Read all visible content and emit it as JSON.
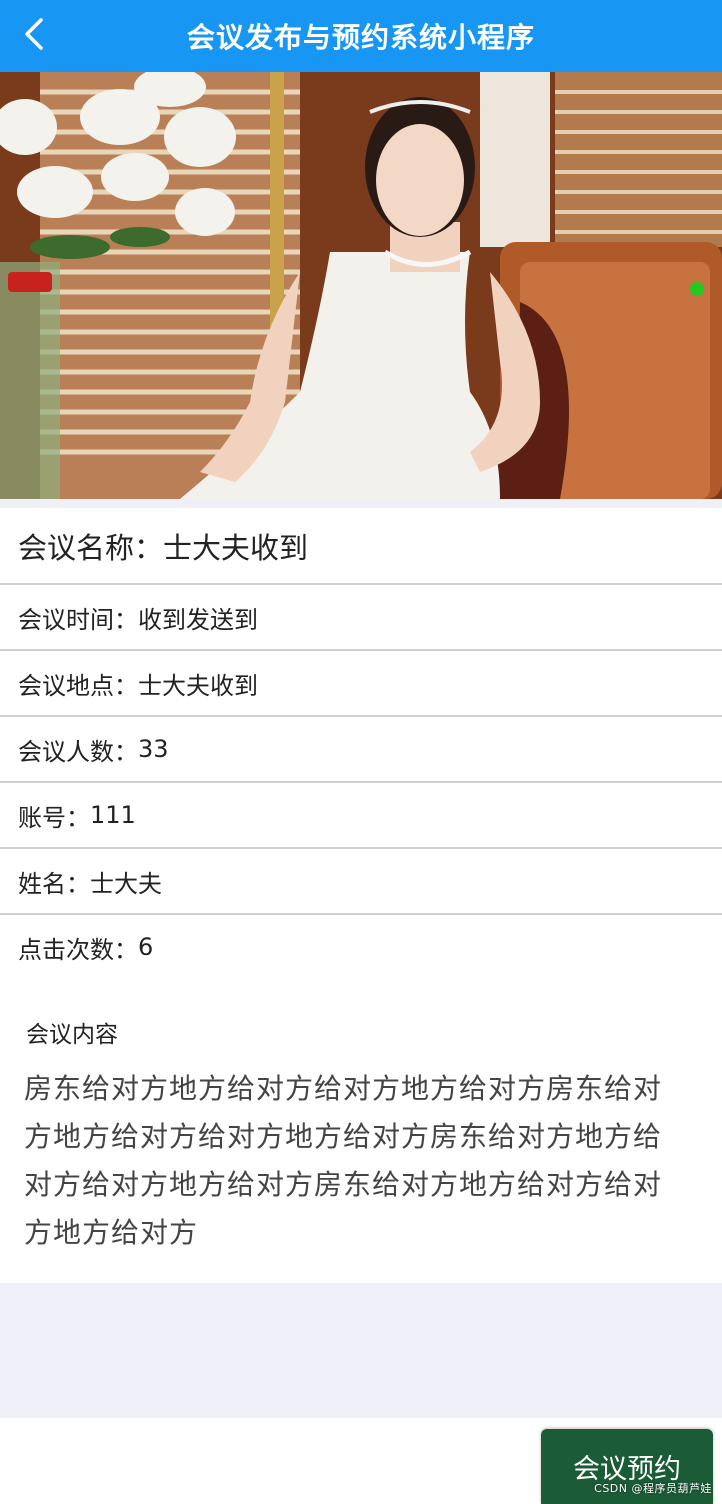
{
  "app": {
    "title": "会议发布与预约系统小程序"
  },
  "nav": {
    "back_icon": "chevron-left-icon"
  },
  "hero": {
    "alt": "会议图片"
  },
  "meeting": {
    "name_label": "会议名称：",
    "name_value": "士大夫收到",
    "time_label": "会议时间：",
    "time_value": "收到发送到",
    "location_label": "会议地点：",
    "location_value": "士大夫收到",
    "people_label": "会议人数：",
    "people_value": "33",
    "account_label": "账号：",
    "account_value": "111",
    "username_label": "姓名：",
    "username_value": "士大夫",
    "clicks_label": "点击次数：",
    "clicks_value": "6"
  },
  "content": {
    "title": "会议内容",
    "body": "房东给对方地方给对方给对方地方给对方房东给对方地方给对方给对方地方给对方房东给对方地方给对方给对方地方给对方房东给对方地方给对方给对方地方给对方"
  },
  "actions": {
    "book_label": "会议预约"
  },
  "watermark": "CSDN @程序员葫芦娃",
  "colors": {
    "accent": "#1797f3",
    "book_button": "#1b5c37",
    "page_bg": "#efeff8"
  }
}
